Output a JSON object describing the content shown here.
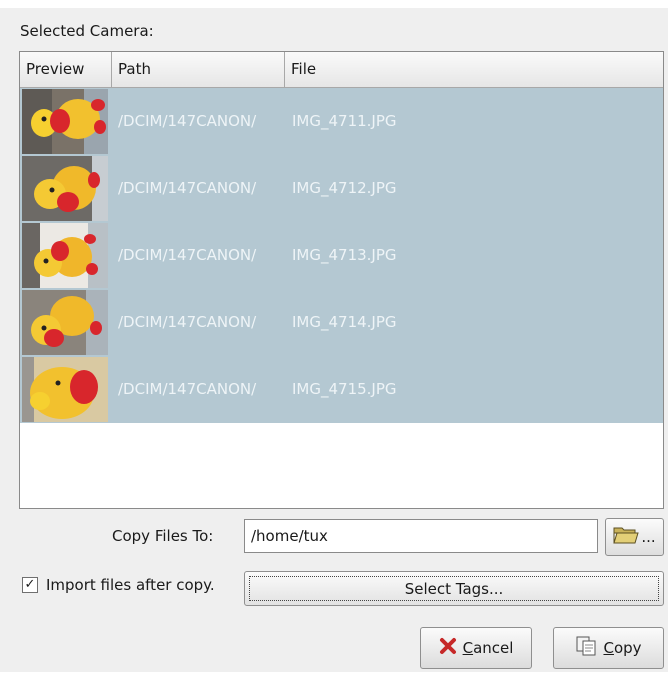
{
  "dialog": {
    "selected_camera_label": "Selected Camera:"
  },
  "list": {
    "columns": [
      "Preview",
      "Path",
      "File"
    ],
    "rows": [
      {
        "path": "/DCIM/147CANON/",
        "file": "IMG_4711.JPG"
      },
      {
        "path": "/DCIM/147CANON/",
        "file": "IMG_4712.JPG"
      },
      {
        "path": "/DCIM/147CANON/",
        "file": "IMG_4713.JPG"
      },
      {
        "path": "/DCIM/147CANON/",
        "file": "IMG_4714.JPG"
      },
      {
        "path": "/DCIM/147CANON/",
        "file": "IMG_4715.JPG"
      }
    ],
    "selected_row_color": "#b4c8d2"
  },
  "destination": {
    "label": "Copy Files To:",
    "value": "/home/tux",
    "browse_icon": "folder-open-icon",
    "browse_label": "..."
  },
  "import": {
    "checked": true,
    "checkbox_glyph": "✓",
    "label": "Import files after copy."
  },
  "buttons": {
    "select_tags": "Select Tags...",
    "cancel_mnemonic": "C",
    "cancel_rest": "ancel",
    "cancel_icon": "red-x-icon",
    "copy_mnemonic": "C",
    "copy_rest": "opy",
    "copy_icon": "copy-pages-icon"
  }
}
